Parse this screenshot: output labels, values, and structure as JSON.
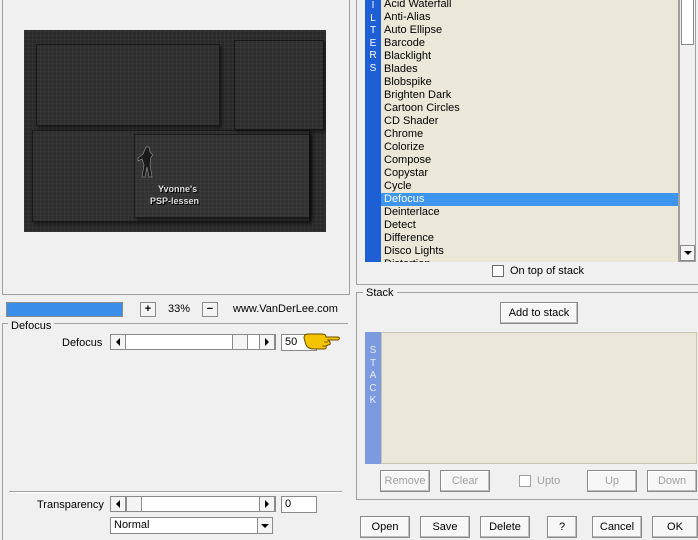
{
  "preview": {
    "watermark_line1": "Yvonne's",
    "watermark_line2": "PSP-lessen"
  },
  "zoom": {
    "plus_label": "+",
    "minus_label": "−",
    "value": "33%",
    "progress_fraction": 1.0,
    "brand": "www.VanDerLee.com"
  },
  "defocus_group": {
    "title": "Defocus",
    "param_label": "Defocus",
    "value": "50",
    "slider_fraction": 0.9
  },
  "transparency": {
    "label": "Transparency",
    "value": "0",
    "slider_fraction": 0.0,
    "blend_mode": "Normal"
  },
  "filters": {
    "strip_letters": "I L T E R S",
    "items": [
      "Acid Waterfall",
      "Anti-Alias",
      "Auto Ellipse",
      "Barcode",
      "Blacklight",
      "Blades",
      "Blobspike",
      "Brighten Dark",
      "Cartoon Circles",
      "CD Shader",
      "Chrome",
      "Colorize",
      "Compose",
      "Copystar",
      "Cycle",
      "Defocus",
      "Deinterlace",
      "Detect",
      "Difference",
      "Disco Lights",
      "Distortion"
    ],
    "selected": "Defocus",
    "on_top_label": "On top of stack",
    "selected_color": "#3d95ee",
    "strip_color": "#1f5fd6"
  },
  "stack": {
    "title": "Stack",
    "add_label": "Add to stack",
    "strip_letters": "S T A C K",
    "remove_label": "Remove",
    "clear_label": "Clear",
    "upto_label": "Upto",
    "up_label": "Up",
    "down_label": "Down"
  },
  "footer": {
    "open_label": "Open",
    "save_label": "Save",
    "delete_label": "Delete",
    "help_label": "?",
    "cancel_label": "Cancel",
    "ok_label": "OK"
  }
}
